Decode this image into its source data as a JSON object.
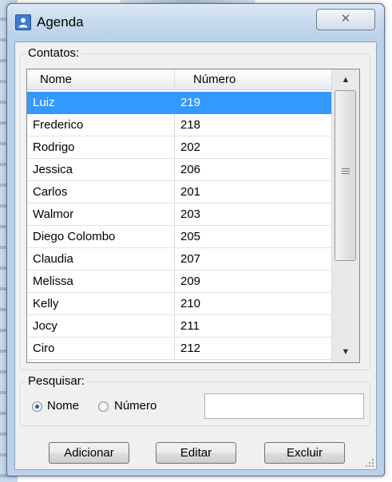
{
  "window": {
    "title": "Agenda",
    "close_glyph": "✕"
  },
  "contacts": {
    "group_label": "Contatos:",
    "columns": [
      "Nome",
      "Número"
    ],
    "rows": [
      {
        "name": "Luiz",
        "number": "219",
        "selected": true
      },
      {
        "name": "Frederico",
        "number": "218"
      },
      {
        "name": "Rodrigo",
        "number": "202"
      },
      {
        "name": "Jessica",
        "number": "206"
      },
      {
        "name": "Carlos",
        "number": "201"
      },
      {
        "name": "Walmor",
        "number": "203"
      },
      {
        "name": "Diego Colombo",
        "number": "205"
      },
      {
        "name": "Claudia",
        "number": "207"
      },
      {
        "name": "Melissa",
        "number": "209"
      },
      {
        "name": "Kelly",
        "number": "210"
      },
      {
        "name": "Jocy",
        "number": "211"
      },
      {
        "name": "Ciro",
        "number": "212"
      }
    ]
  },
  "search": {
    "group_label": "Pesquisar:",
    "option_name": "Nome",
    "option_number": "Número",
    "selected_option": "Nome",
    "value": ""
  },
  "buttons": {
    "add": "Adicionar",
    "edit": "Editar",
    "delete": "Excluir"
  },
  "colors": {
    "selection": "#3399ff",
    "window_frame": "#b9d1ea",
    "client": "#f0f0f0"
  }
}
